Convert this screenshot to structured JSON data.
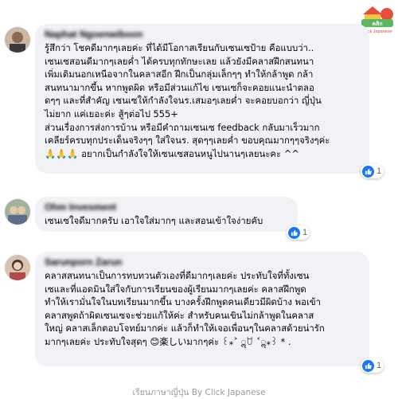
{
  "logo": {
    "label": "Click Japanese"
  },
  "comments": [
    {
      "author": "Naphat Ngoenwiboon",
      "text": "รู้สึกว่า โชคดีมากๆเลยค่ะ ที่ได้มีโอกาสเรียนกับเซนเซป้าย คือแบบว่า..\nเซนเซสอนดีมากๆเลยค่ำ ได้ครบทุกทักษะเลย แล้วยังมีคลาสฝึกสนทนา\nเพิ่มเติมนอกเหนือจากในคลาสอีก ฝึกเป็นกลุ่มเล็กๆๆ ทำให้กล้าพูด กล้า\nสนทนามากขึ้น หากพูดผิด หรือมีส่วนแก้ไข เซนเซก็จะคอยแนะนำตลอ\nดๆๆ และที่สำคัญ เซนเซให้กำลังใจนร.เสมอๆเลยค่ำ จะคอยบอกว่า ญี่ปุ่น\nไม่ยาก แค่เยอะค่ะ สู้ๆต่อไป 555+\nส่วนเรื่องการส่งการบ้าน หรือมีคำถามเซนเซ feedback กลับมาเร็วมาก\nเคลียร์ครบทุกประเด็นจริงๆๆ ใส่ใจนร. สุดๆๆเลยค่ำ ขอบคุณมากๆๆจริงๆค่ะ\n🙏🙏🙏 อยากเป็นกำลังใจให้เซนเซสอนหนูไปนานๆเลยนะคะ ^^",
      "reactions": "1"
    },
    {
      "author": "Ohm Invesment",
      "text": "เซนเซใจดีมากครับ เอาใจใส่มากๆ และสอนเข้าใจง่ายคับ",
      "reactions": "1"
    },
    {
      "author": "Sarunporn Zarun",
      "text": "คลาสสนทนาเป็นการทบทวนตัวเองที่ดีมากๆเลยค่ะ ประทับใจที่ทั้งเซน\nเซและที่แอดมินใส่ใจกับการเรียนของผู้เรียนมากๆเลยค่ะ คลาสฝึกพูด\nทำให้เรามั่นใจในบทเรียนมากขึ้น บางครั้งฝึกพูดคนเดียวมีผิดบ้าง พอเข้า\nคลาสพูดถ้าผิดเซนเซจะช่วยแก้ให้ค่ะ สำหรับคนเขินไม่กล้าพูดในคลาส\nใหญ่ คลาสเล็กตอบโจทย์มากค่ะ แล้วก็ทำให้เจอเพื่อนๆในคลาสด้วยน่ารัก\nมากๆเลยค่ะ ประทับใจสุดๆ 😊楽しいมากๆค่ะ ꒰⁎˃ ॢꇴ ˂ॢ⁎꒱ * .",
      "reactions": "1"
    }
  ],
  "footer": "เรียนภาษาญี่ปุ่น By Click Japanese",
  "colors": {
    "bubble": "#f0f2f5",
    "like": "#1877f2",
    "footer": "#9a9a9a"
  }
}
